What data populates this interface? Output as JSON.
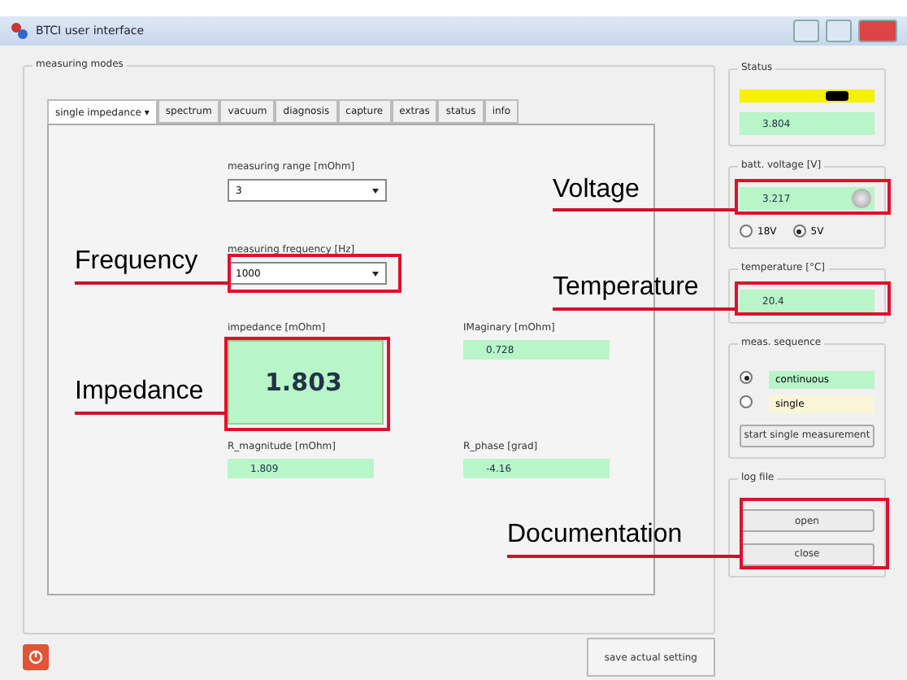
{
  "window": {
    "title": "BTCI user interface"
  },
  "modes": {
    "title": "measuring modes",
    "tabs": [
      {
        "label": "single impedance ▾",
        "selected": true
      },
      {
        "label": "spectrum",
        "selected": false
      },
      {
        "label": "vacuum",
        "selected": false
      },
      {
        "label": "diagnosis",
        "selected": false
      },
      {
        "label": "capture",
        "selected": false
      },
      {
        "label": "extras",
        "selected": false
      },
      {
        "label": "status",
        "selected": false
      },
      {
        "label": "info",
        "selected": false
      }
    ],
    "range": {
      "label": "measuring range [mOhm]",
      "value": "3"
    },
    "frequency": {
      "label": "measuring frequency [Hz]",
      "value": "1000"
    },
    "impedance": {
      "label": "impedance [mOhm]",
      "value": "1.803"
    },
    "imaginary": {
      "label": "IMaginary [mOhm]",
      "value": "0.728"
    },
    "magnitude": {
      "label": "R_magnitude [mOhm]",
      "value": "1.809"
    },
    "phase": {
      "label": "R_phase [grad]",
      "value": "-4.16"
    }
  },
  "status": {
    "title": "Status",
    "level": 0.72,
    "reading": "3.804"
  },
  "voltage": {
    "title": "batt. voltage [V]",
    "value": "3.217",
    "options": [
      {
        "label": "18V",
        "selected": false
      },
      {
        "label": "5V",
        "selected": true
      }
    ]
  },
  "temperature": {
    "title": "temperature [°C]",
    "value": "20.4"
  },
  "sequence": {
    "title": "meas. sequence",
    "options": [
      {
        "label": "continuous",
        "selected": true
      },
      {
        "label": "single",
        "selected": false
      }
    ],
    "button": "start single measurement"
  },
  "log_file": {
    "title": "log file",
    "buttons": [
      "open",
      "close"
    ]
  },
  "footer": {
    "button": "save actual setting"
  },
  "annotations": [
    {
      "label": "Voltage"
    },
    {
      "label": "Frequency"
    },
    {
      "label": "Temperature"
    },
    {
      "label": "Impedance"
    },
    {
      "label": "Documentation"
    }
  ]
}
